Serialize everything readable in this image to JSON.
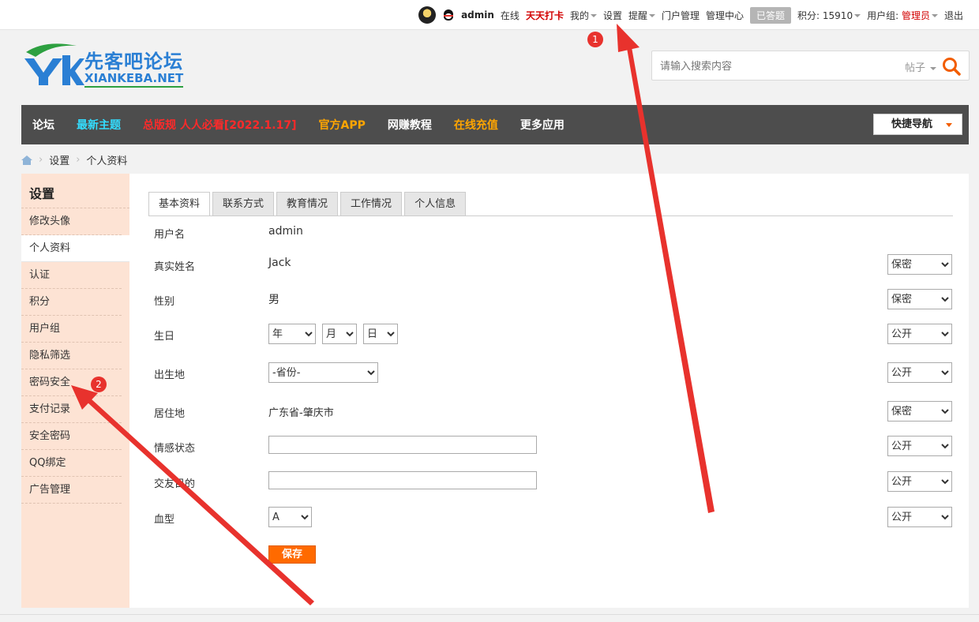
{
  "topbar": {
    "username": "admin",
    "online": "在线",
    "checkin": "天天打卡",
    "mine": "我的",
    "settings": "设置",
    "remind": "提醒",
    "portal": "门户管理",
    "admin_center": "管理中心",
    "answered": "已答题",
    "points": "积分: 15910",
    "usergroup_label": "用户组:",
    "usergroup_value": "管理员",
    "logout": "退出"
  },
  "logo": {
    "cn": "先客吧论坛",
    "en": "XIANKEBA.NET"
  },
  "search": {
    "placeholder": "请输入搜索内容",
    "type": "帖子"
  },
  "nav": {
    "items": [
      {
        "label": "论坛",
        "color": "#ffffff"
      },
      {
        "label": "最新主题",
        "color": "#33ddff"
      },
      {
        "label": "总版规 人人必看[2022.1.17]",
        "color": "#ff2a2a"
      },
      {
        "label": "官方APP",
        "color": "#ffa500"
      },
      {
        "label": "网赚教程",
        "color": "#ffffff"
      },
      {
        "label": "在线充值",
        "color": "#ffa500"
      },
      {
        "label": "更多应用",
        "color": "#ffffff"
      }
    ],
    "quicknav": "快捷导航"
  },
  "breadcrumb": {
    "items": [
      "设置",
      "个人资料"
    ]
  },
  "sidebar": {
    "title": "设置",
    "items": [
      "修改头像",
      "个人资料",
      "认证",
      "积分",
      "用户组",
      "隐私筛选",
      "密码安全",
      "支付记录",
      "安全密码",
      "QQ绑定",
      "广告管理"
    ],
    "active": "个人资料"
  },
  "tabs": [
    "基本资料",
    "联系方式",
    "教育情况",
    "工作情况",
    "个人信息"
  ],
  "form": {
    "username": {
      "label": "用户名",
      "value": "admin"
    },
    "realname": {
      "label": "真实姓名",
      "value": "Jack",
      "privacy": "保密"
    },
    "gender": {
      "label": "性别",
      "value": "男",
      "privacy": "保密"
    },
    "birthday": {
      "label": "生日",
      "year": "年",
      "month": "月",
      "day": "日",
      "privacy": "公开"
    },
    "birthplace": {
      "label": "出生地",
      "province": "-省份-",
      "privacy": "公开"
    },
    "residence": {
      "label": "居住地",
      "value": "广东省-肇庆市",
      "privacy": "保密"
    },
    "affective": {
      "label": "情感状态",
      "value": "",
      "privacy": "公开"
    },
    "lookingfor": {
      "label": "交友目的",
      "value": "",
      "privacy": "公开"
    },
    "bloodtype": {
      "label": "血型",
      "value": "A",
      "privacy": "公开"
    },
    "save": "保存"
  },
  "annotations": {
    "badge1": "1",
    "badge2": "2",
    "arrow_color": "#e8322d"
  }
}
